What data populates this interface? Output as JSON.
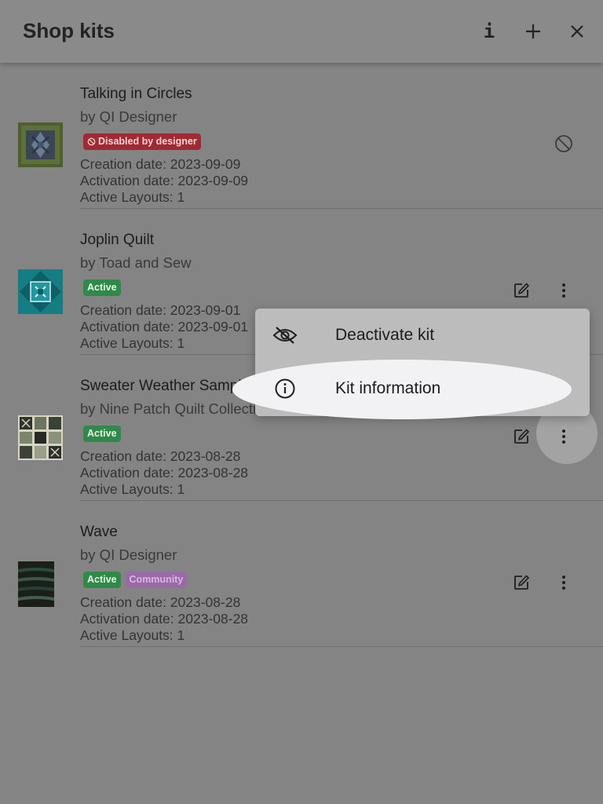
{
  "header": {
    "title": "Shop kits",
    "actions": [
      {
        "name": "info-icon",
        "label": "i"
      },
      {
        "name": "plus-icon",
        "label": "+"
      },
      {
        "name": "close-icon",
        "label": "×"
      }
    ]
  },
  "kits": [
    {
      "name": "Talking in Circles",
      "author": "by QI Designer",
      "badges": [
        {
          "type": "disabled",
          "label": "Disabled by designer"
        }
      ],
      "creation": "Creation date: 2023-09-09",
      "activation": "Activation date: 2023-09-09",
      "layouts": "Active Layouts: 1",
      "actions": [
        "block-icon"
      ]
    },
    {
      "name": "Joplin Quilt",
      "author": "by Toad and Sew",
      "badges": [
        {
          "type": "active",
          "label": "Active"
        }
      ],
      "creation": "Creation date: 2023-09-01",
      "activation": "Activation date: 2023-09-01",
      "layouts": "Active Layouts: 1",
      "actions": [
        "edit-icon",
        "more-vert-icon"
      ]
    },
    {
      "name": "Sweater Weather Sampler",
      "author": "by Nine Patch Quilt Collective",
      "badges": [
        {
          "type": "active",
          "label": "Active"
        }
      ],
      "creation": "Creation date: 2023-08-28",
      "activation": "Activation date: 2023-08-28",
      "layouts": "Active Layouts: 1",
      "actions": [
        "edit-icon",
        "more-vert-icon"
      ]
    },
    {
      "name": "Wave",
      "author": "by QI Designer",
      "badges": [
        {
          "type": "active",
          "label": "Active"
        },
        {
          "type": "community",
          "label": "Community"
        }
      ],
      "creation": "Creation date: 2023-08-28",
      "activation": "Activation date: 2023-08-28",
      "layouts": "Active Layouts: 1",
      "actions": [
        "edit-icon",
        "more-vert-icon"
      ]
    }
  ],
  "menu": {
    "items": [
      {
        "label": "Deactivate kit",
        "icon": "eye-off-icon"
      },
      {
        "label": "Kit information",
        "icon": "info-circle-icon"
      }
    ]
  },
  "colors": {
    "scrim": "#848484",
    "active_badge": "#2f8a47",
    "disabled_badge": "#a12a32",
    "community_badge": "#9a6aa8",
    "menu_bg": "#bcbcbc"
  }
}
